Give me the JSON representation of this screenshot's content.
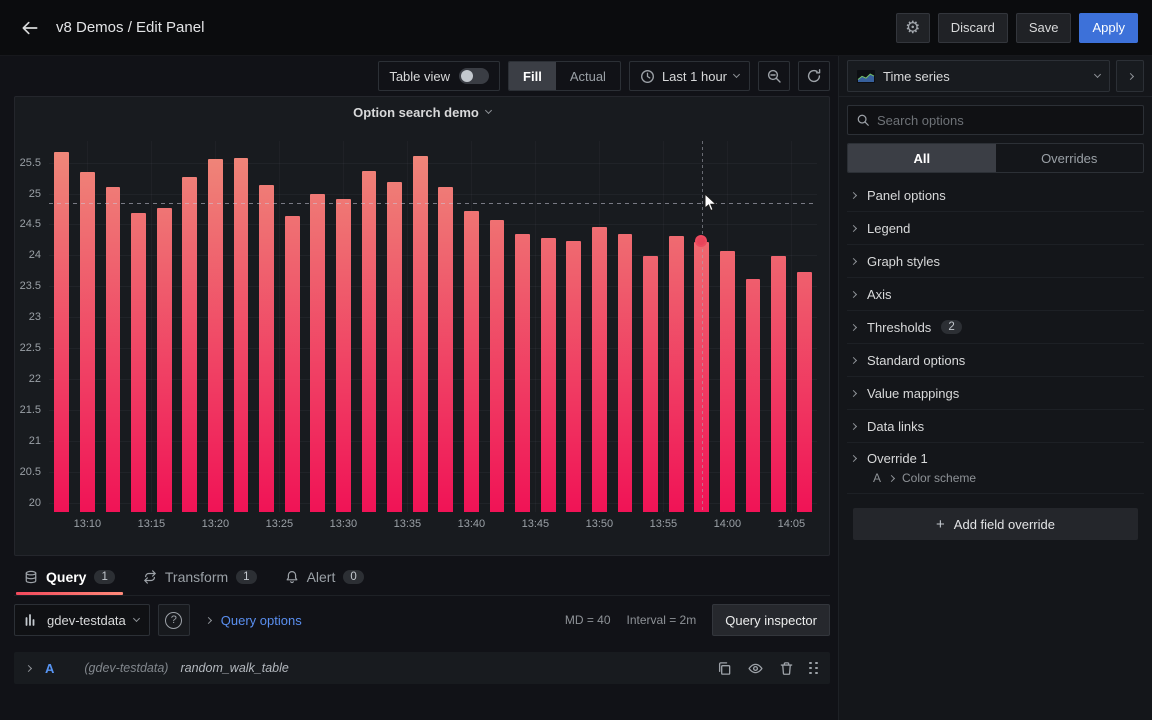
{
  "header": {
    "title": "v8 Demos / Edit Panel",
    "discard_label": "Discard",
    "save_label": "Save",
    "apply_label": "Apply"
  },
  "icons": {
    "gear": "⚙",
    "help": "?",
    "plus": "+"
  },
  "toolbar": {
    "table_view_label": "Table view",
    "fill_label": "Fill",
    "actual_label": "Actual",
    "time_range_label": "Last 1 hour"
  },
  "chart_data": {
    "type": "bar",
    "title": "Option search demo",
    "x": [
      "13:08",
      "13:10",
      "13:12",
      "13:14",
      "13:16",
      "13:18",
      "13:20",
      "13:22",
      "13:24",
      "13:26",
      "13:28",
      "13:30",
      "13:32",
      "13:34",
      "13:36",
      "13:38",
      "13:40",
      "13:42",
      "13:44",
      "13:46",
      "13:48",
      "13:50",
      "13:52",
      "13:54",
      "13:56",
      "13:58",
      "14:00",
      "14:02",
      "14:04",
      "14:06"
    ],
    "values": [
      25.68,
      25.35,
      25.1,
      24.68,
      24.77,
      25.27,
      25.56,
      25.57,
      25.14,
      24.64,
      24.99,
      24.92,
      25.37,
      25.19,
      25.61,
      25.11,
      24.72,
      24.57,
      24.35,
      24.28,
      24.24,
      24.46,
      24.34,
      23.99,
      24.31,
      24.21,
      24.07,
      23.62,
      23.99,
      23.73
    ],
    "x_tick_labels": [
      "13:10",
      "13:15",
      "13:20",
      "13:25",
      "13:30",
      "13:35",
      "13:40",
      "13:45",
      "13:50",
      "13:55",
      "14:00",
      "14:05"
    ],
    "x_start": "13:07",
    "x_end": "14:07",
    "y_ticks": [
      20,
      20.5,
      21,
      21.5,
      22,
      22.5,
      23,
      23.5,
      24,
      24.5,
      25,
      25.5
    ],
    "ylim": [
      19.85,
      25.85
    ],
    "threshold_value": 24.85,
    "hover_index": 25,
    "bar_color_low": "#f01356",
    "bar_color_high": "#ef8a7a",
    "grid": true,
    "legend": "none"
  },
  "sidebar": {
    "viz_label": "Time series",
    "search_placeholder": "Search options",
    "tab_all": "All",
    "tab_overrides": "Overrides",
    "options": [
      {
        "label": "Panel options"
      },
      {
        "label": "Legend"
      },
      {
        "label": "Graph styles"
      },
      {
        "label": "Axis"
      },
      {
        "label": "Thresholds",
        "badge": "2"
      },
      {
        "label": "Standard options"
      },
      {
        "label": "Value mappings"
      },
      {
        "label": "Data links"
      },
      {
        "label": "Override 1",
        "sub_ref": "A",
        "sub_label": "Color scheme"
      }
    ],
    "add_override_label": "Add field override"
  },
  "query": {
    "tabs": [
      {
        "label": "Query",
        "badge": "1"
      },
      {
        "label": "Transform",
        "badge": "1"
      },
      {
        "label": "Alert",
        "badge": "0"
      }
    ],
    "datasource": "gdev-testdata",
    "options_label": "Query options",
    "md_text": "MD = 40",
    "interval_text": "Interval = 2m",
    "inspector_label": "Query inspector",
    "row": {
      "ref_id": "A",
      "datasource": "(gdev-testdata)",
      "scenario": "random_walk_table"
    }
  }
}
